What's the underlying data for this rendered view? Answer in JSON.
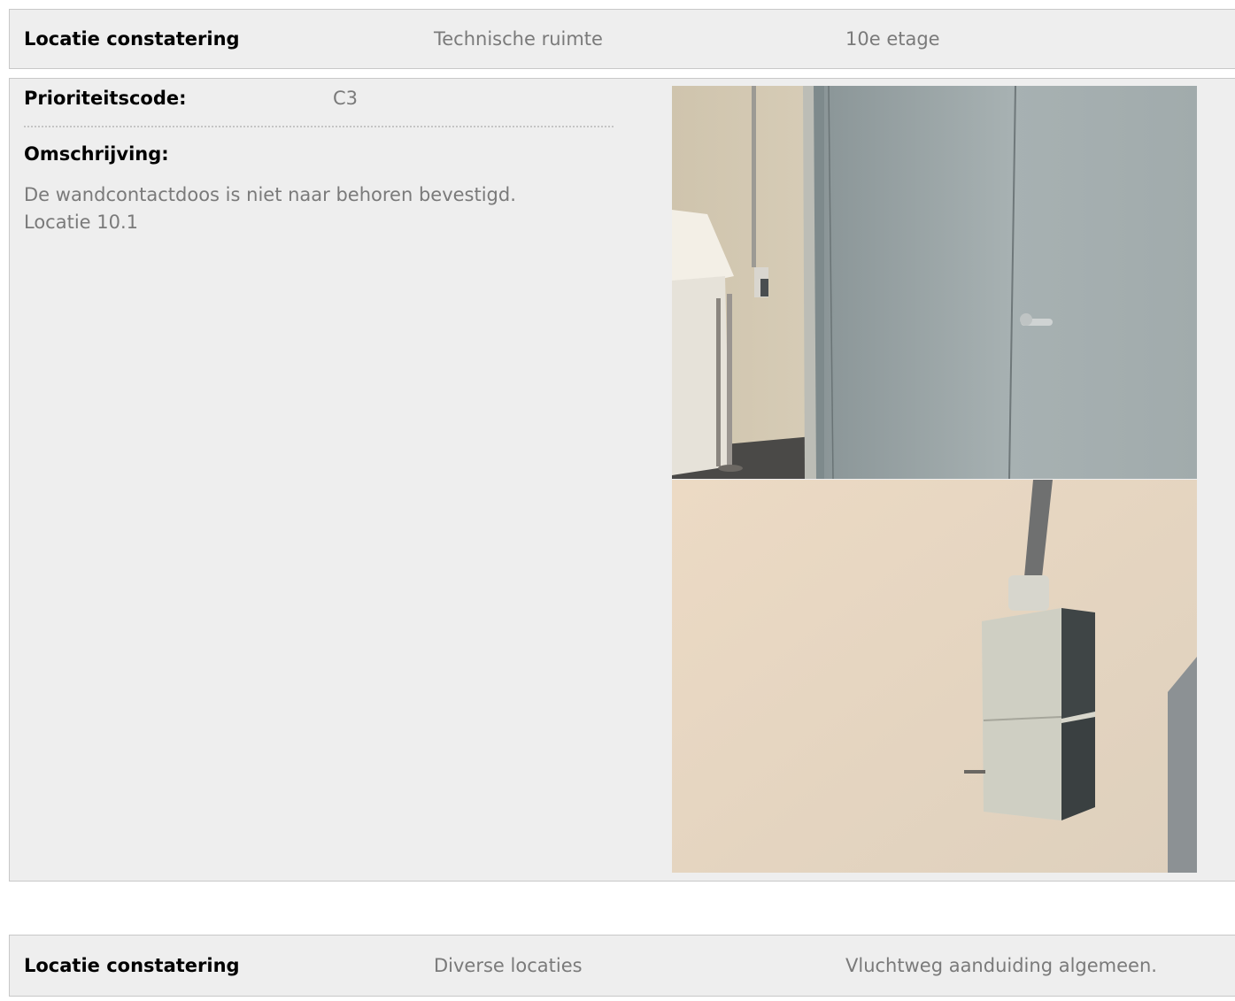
{
  "entries": [
    {
      "header": {
        "label": "Locatie constatering",
        "location": "Technische ruimte",
        "detail": "10e etage"
      },
      "priority_label": "Prioriteitscode:",
      "priority_value": "C3",
      "description_label": "Omschrijving:",
      "description_lines": [
        "De wandcontactdoos is niet naar behoren bevestigd.",
        "Locatie 10.1"
      ]
    },
    {
      "header": {
        "label": "Locatie constatering",
        "location": "Diverse locaties",
        "detail": "Vluchtweg aanduiding algemeen."
      }
    }
  ]
}
